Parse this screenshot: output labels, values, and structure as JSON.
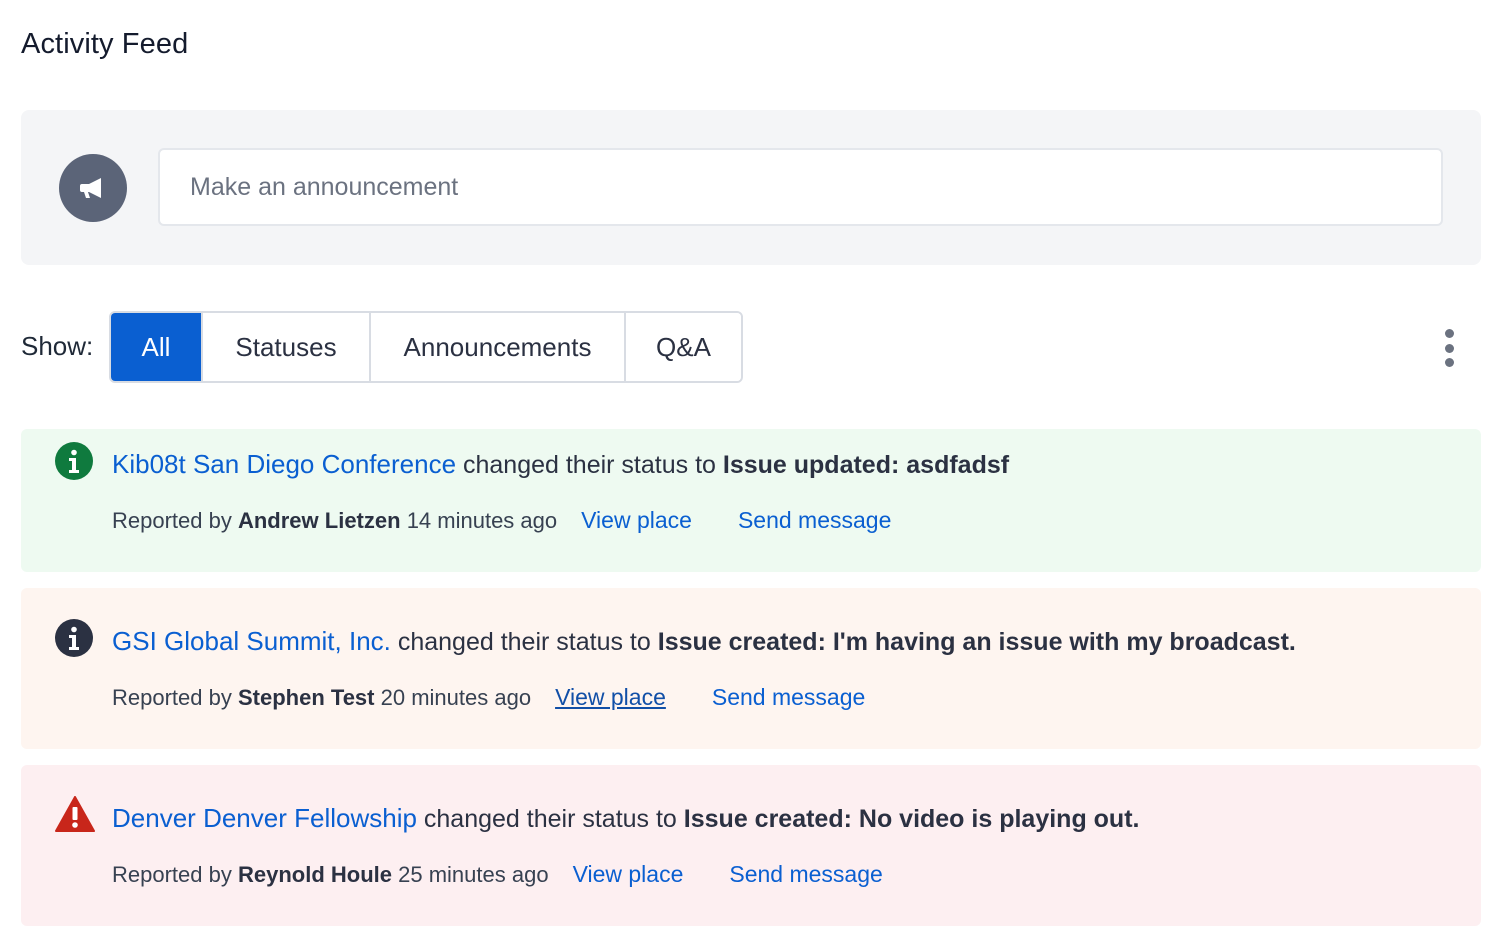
{
  "page": {
    "title": "Activity Feed"
  },
  "composer": {
    "icon": "megaphone-icon",
    "placeholder": "Make an announcement"
  },
  "filters": {
    "label": "Show:",
    "options": [
      "All",
      "Statuses",
      "Announcements",
      "Q&A"
    ],
    "active": "All",
    "more_icon": "vertical-dots-icon"
  },
  "feed": [
    {
      "severity": "info",
      "icon": "info-circle-icon",
      "icon_color": "#0f7a3e",
      "background": "#eefaf1",
      "place_code": "Kib08t",
      "place_name": "San Diego Conference",
      "verb": "changed their status to",
      "status_label": "Issue updated:",
      "status_detail": "asdfadsf",
      "reported_by_label": "Reported by",
      "reporter": "Andrew Lietzen",
      "time": "14 minutes ago",
      "view_place": "View place",
      "send_message": "Send message"
    },
    {
      "severity": "info",
      "icon": "info-circle-icon",
      "icon_color": "#2b3142",
      "background": "#fef5f0",
      "place_code": "GSI",
      "place_name": "Global Summit, Inc.",
      "verb": "changed their status to",
      "status_label": "Issue created:",
      "status_detail": "I'm having an issue with my broadcast.",
      "reported_by_label": "Reported by",
      "reporter": "Stephen Test",
      "time": "20 minutes ago",
      "view_place": "View place",
      "send_message": "Send message"
    },
    {
      "severity": "error",
      "icon": "warning-triangle-icon",
      "icon_color": "#c8261a",
      "background": "#fdeff1",
      "place_code": "Denver",
      "place_name": "Denver Fellowship",
      "verb": "changed their status to",
      "status_label": "Issue created:",
      "status_detail": "No video is playing out.",
      "reported_by_label": "Reported by",
      "reporter": "Reynold Houle",
      "time": "25 minutes ago",
      "view_place": "View place",
      "send_message": "Send message"
    }
  ]
}
